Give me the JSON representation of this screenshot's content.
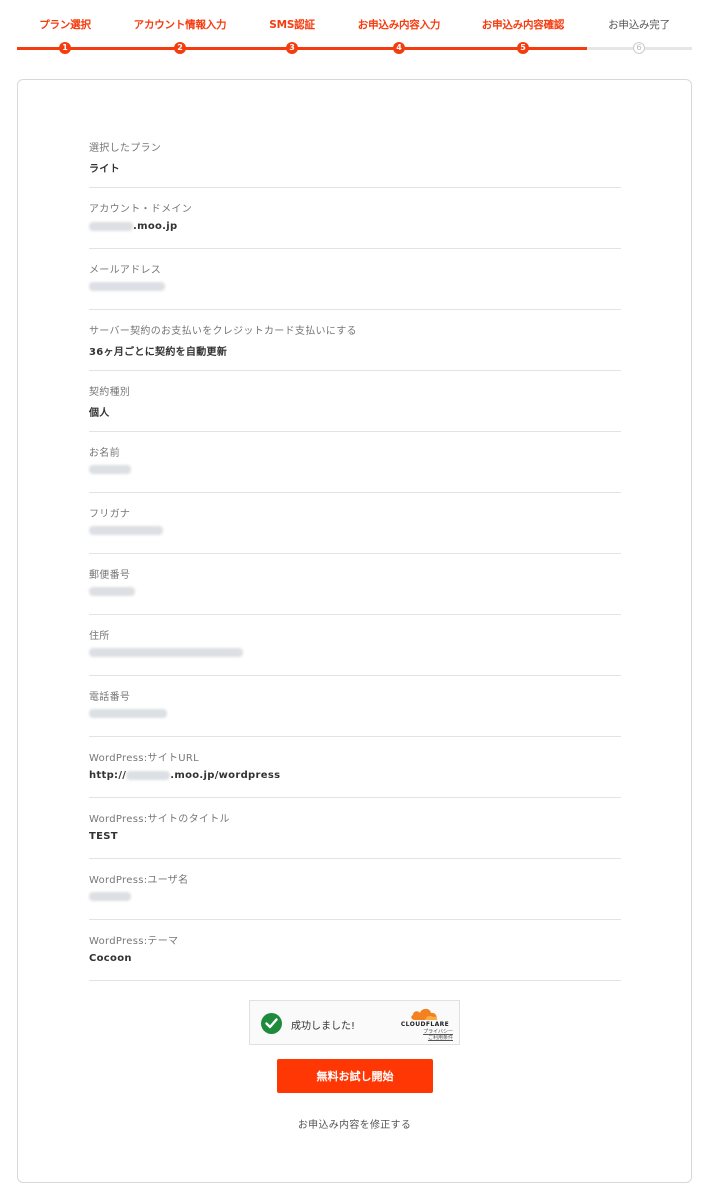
{
  "steps": [
    {
      "label": "プラン選択",
      "num": "1",
      "state": "done"
    },
    {
      "label": "アカウント情報入力",
      "num": "2",
      "state": "done"
    },
    {
      "label": "SMS認証",
      "num": "3",
      "state": "done"
    },
    {
      "label": "お申込み内容入力",
      "num": "4",
      "state": "done"
    },
    {
      "label": "お申込み内容確認",
      "num": "5",
      "state": "current"
    },
    {
      "label": "お申込み完了",
      "num": "6",
      "state": "pending"
    }
  ],
  "rows": [
    {
      "label": "選択したプラン",
      "value": "ライト"
    },
    {
      "label": "アカウント・ドメイン",
      "value_suffix": ".moo.jp"
    },
    {
      "label": "メールアドレス"
    },
    {
      "label": "サーバー契約のお支払いをクレジットカード支払いにする",
      "value": "36ヶ月ごとに契約を自動更新"
    },
    {
      "label": "契約種別",
      "value": "個人"
    },
    {
      "label": "お名前"
    },
    {
      "label": "フリガナ"
    },
    {
      "label": "郵便番号"
    },
    {
      "label": "住所"
    },
    {
      "label": "電話番号"
    },
    {
      "label": "WordPress:サイトURL",
      "value_prefix": "http://",
      "value_suffix": ".moo.jp/wordpress"
    },
    {
      "label": "WordPress:サイトのタイトル",
      "value": "TEST"
    },
    {
      "label": "WordPress:ユーザ名"
    },
    {
      "label": "WordPress:テーマ",
      "value": "Cocoon"
    }
  ],
  "captcha": {
    "success_text": "成功しました!",
    "brand": "CLOUDFLARE",
    "privacy_link": "プライバシー",
    "terms_link": "ご利用条件"
  },
  "actions": {
    "start_label": "無料お試し開始",
    "modify_label": "お申込み内容を修正する"
  },
  "colors": {
    "accent": "#f53c0f",
    "button": "#ff3705",
    "success": "#1e8a3c"
  }
}
